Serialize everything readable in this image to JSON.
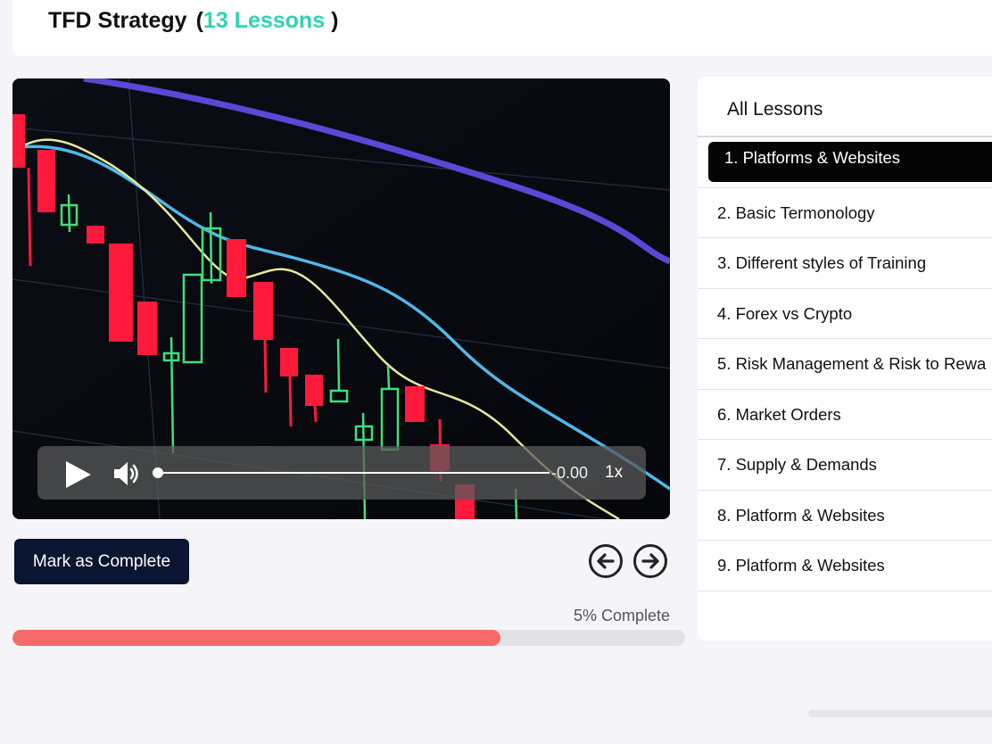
{
  "header": {
    "course_title": "TFD Strategy",
    "paren_open": "(",
    "lessons_count": "13 Lessons",
    "paren_close": ")"
  },
  "player": {
    "time": "-0.00",
    "speed": "1x",
    "play_icon": "play-icon",
    "volume_icon": "volume-icon"
  },
  "actions": {
    "mark_complete": "Mark as Complete",
    "prev_icon": "arrow-left-circle-icon",
    "next_icon": "arrow-right-circle-icon"
  },
  "progress": {
    "label": "5% Complete",
    "fill_fraction": 0.725,
    "fill_color": "#f76a6a"
  },
  "lessons_panel": {
    "title": "All Lessons",
    "items": [
      {
        "label": "1. Platforms & Websites",
        "active": true
      },
      {
        "label": "2. Basic Termonology"
      },
      {
        "label": "3. Different styles of Training"
      },
      {
        "label": "4. Forex vs Crypto"
      },
      {
        "label": "5. Risk Management & Risk to Rewa"
      },
      {
        "label": "6. Market Orders"
      },
      {
        "label": "7. Supply & Demands"
      },
      {
        "label": "8. Platform & Websites"
      },
      {
        "label": "9. Platform & Websites"
      }
    ]
  },
  "colors": {
    "accent": "#2ed3b0",
    "button_dark": "#0a1532",
    "active_lesson": "#050505"
  }
}
